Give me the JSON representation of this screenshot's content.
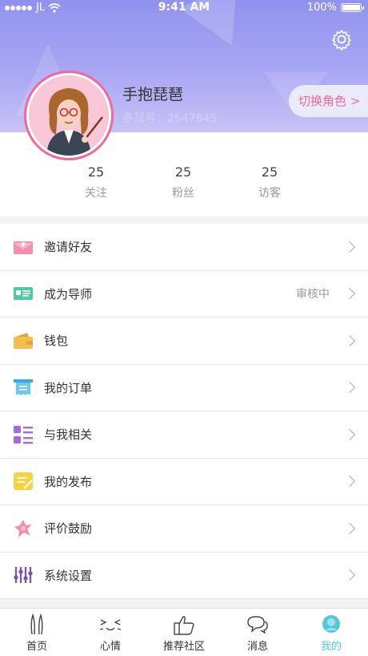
{
  "status_bar": {
    "carrier": "JL",
    "time": "9:41 AM",
    "battery": "100%"
  },
  "profile": {
    "name": "手抱琵琶",
    "id_label": "多耳号：2547845",
    "switch_role_label": "切换角色 >"
  },
  "stats": [
    {
      "value": "25",
      "label": "关注"
    },
    {
      "value": "25",
      "label": "粉丝"
    },
    {
      "value": "25",
      "label": "访客"
    }
  ],
  "menu": [
    {
      "label": "邀请好友",
      "extra": "",
      "icon": "envelope-icon"
    },
    {
      "label": "成为导师",
      "extra": "审核中",
      "icon": "id-card-icon"
    },
    {
      "label": "钱包",
      "extra": "",
      "icon": "wallet-icon"
    },
    {
      "label": "我的订单",
      "extra": "",
      "icon": "receipt-icon"
    },
    {
      "label": "与我相关",
      "extra": "",
      "icon": "list-icon"
    },
    {
      "label": "我的发布",
      "extra": "",
      "icon": "note-icon"
    },
    {
      "label": "评价鼓励",
      "extra": "",
      "icon": "flower-icon"
    },
    {
      "label": "系统设置",
      "extra": "",
      "icon": "sliders-icon"
    }
  ],
  "tabs": [
    {
      "label": "首页",
      "icon": "bunny-icon",
      "active": false
    },
    {
      "label": "心情",
      "icon": "face-icon",
      "active": false
    },
    {
      "label": "推荐社区",
      "icon": "thumbs-up-icon",
      "active": false
    },
    {
      "label": "消息",
      "icon": "chat-icon",
      "active": false
    },
    {
      "label": "我的",
      "icon": "me-icon",
      "active": true
    }
  ],
  "colors": {
    "accent": "#52c9d9",
    "header_top": "#8f92ee",
    "pink": "#f2669d"
  }
}
